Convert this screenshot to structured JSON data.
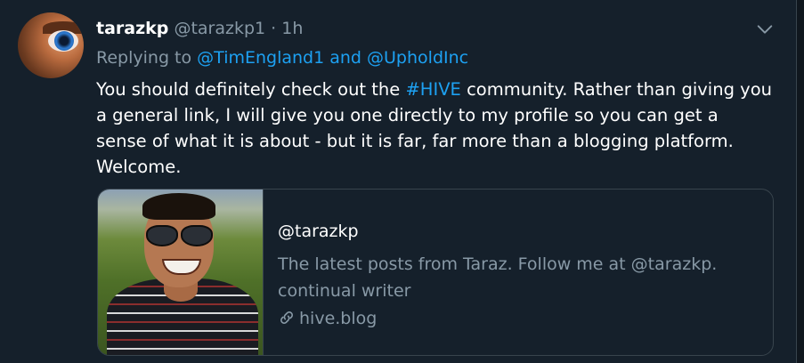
{
  "tweet": {
    "display_name": "tarazkp",
    "handle": "@tarazkp1",
    "separator": "·",
    "time": "1h",
    "reply_prefix": "Replying to",
    "reply_to": "@TimEngland1 and @UpholdInc",
    "text_before_hashtag": "You should definitely check out the ",
    "hashtag": "#HIVE",
    "text_after_hashtag": " community. Rather than giving you a general link, I will give you one directly to my profile so you can get a sense of what it is about - but it is far, far more than a blogging platform. Welcome."
  },
  "card": {
    "title": "@tarazkp",
    "description": "The latest posts from Taraz. Follow me at @tarazkp. continual writer",
    "domain": "hive.blog"
  },
  "icons": {
    "menu": "chevron-down-icon",
    "link": "link-icon"
  },
  "colors": {
    "background": "#15202b",
    "accent": "#1da1f2",
    "secondary_text": "#8899a6",
    "border": "#38444d"
  }
}
